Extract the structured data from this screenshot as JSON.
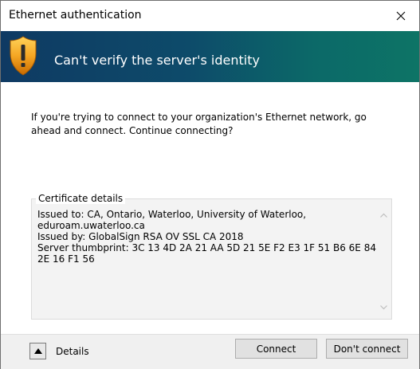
{
  "window": {
    "title": "Ethernet authentication"
  },
  "banner": {
    "heading": "Can't verify the server's identity",
    "icon": "warning-shield-icon",
    "gradient_start": "#0f3a63",
    "gradient_end": "#0d7466"
  },
  "message": "If you're trying to connect to your organization's Ethernet network, go ahead and connect. Continue connecting?",
  "certificate": {
    "legend": "Certificate details",
    "lines": [
      "Issued to: CA, Ontario, Waterloo, University of Waterloo,",
      "eduroam.uwaterloo.ca",
      "Issued by: GlobalSign RSA OV SSL CA 2018",
      "Server thumbprint: 3C 13 4D 2A 21 AA 5D 21 5E F2 E3 1F 51 B6 6E 84",
      "2E 16 F1 56"
    ]
  },
  "footer": {
    "details_label": "Details",
    "connect_label": "Connect",
    "dont_connect_label": "Don't connect"
  }
}
